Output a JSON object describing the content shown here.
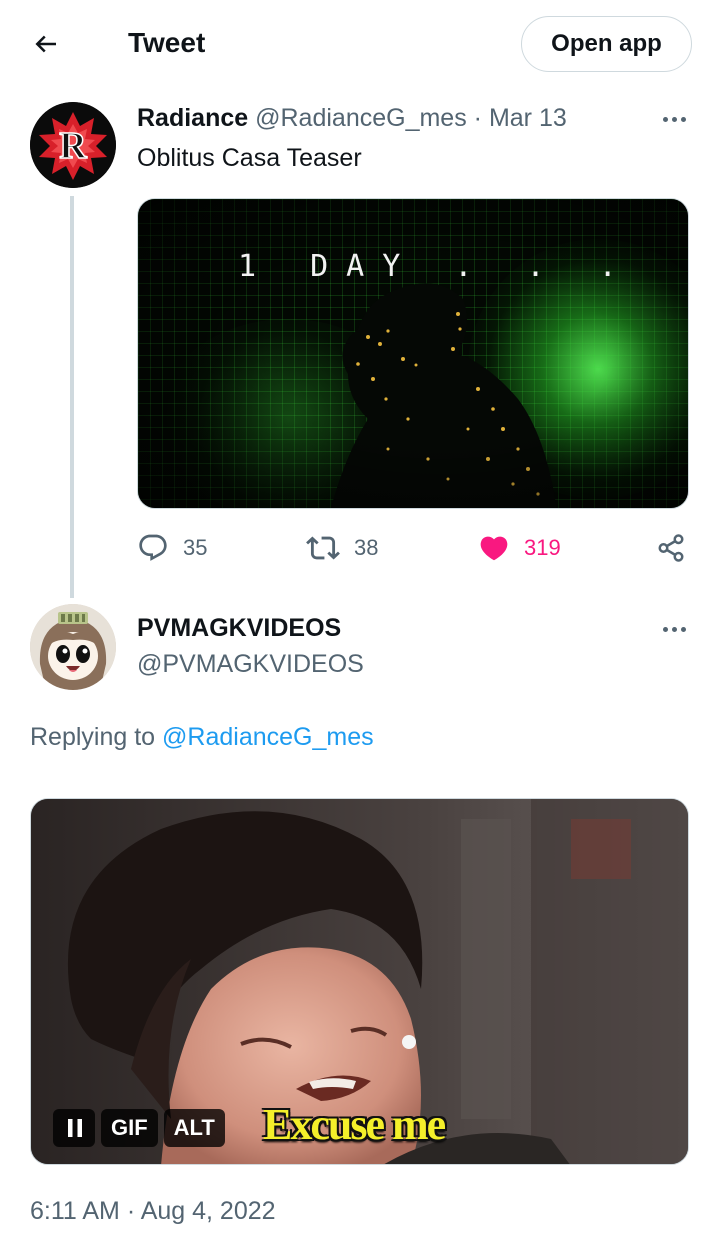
{
  "header": {
    "title": "Tweet",
    "open_app_label": "Open app",
    "back_icon": "arrow-left-icon"
  },
  "tweet": {
    "author_name": "Radiance",
    "author_handle": "@RadianceG_mes",
    "date": "Mar 13",
    "separator": "·",
    "text": "Oblitus Casa Teaser",
    "media_overlay_text": "1 DAY . . .",
    "actions": {
      "replies": "35",
      "retweets": "38",
      "likes": "319"
    }
  },
  "reply": {
    "author_name": "PVMAGKVIDEOS",
    "author_handle": "@PVMAGKVIDEOS",
    "replying_prefix": "Replying to",
    "replying_to": "@RadianceG_mes",
    "gif": {
      "gif_label": "GIF",
      "alt_label": "ALT",
      "caption": "Excuse me"
    },
    "timestamp": "6:11 AM · Aug 4, 2022"
  },
  "colors": {
    "text_primary": "#0f1419",
    "text_secondary": "#536471",
    "link": "#1d9bf0",
    "like_active": "#f91880",
    "border": "#cfd9de"
  }
}
